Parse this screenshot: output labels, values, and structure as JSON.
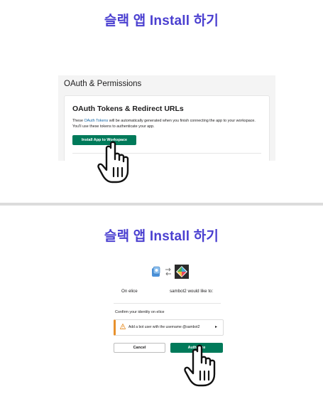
{
  "top_slide": {
    "heading": "슬랙 앱 Install 하기",
    "panel_title": "OAuth & Permissions",
    "card_title": "OAuth Tokens & Redirect URLs",
    "description_prefix": "These ",
    "description_link": "OAuth Tokens",
    "description_suffix": " will be automatically generated when you finish connecting the app to your workspace. You'll use these tokens to authenticate your app.",
    "install_button": "Install App to Workspace"
  },
  "bottom_slide": {
    "heading": "슬랙 앱 Install 하기",
    "workspace_name": "On elice",
    "request_text": "sambot2 would like to:",
    "confirm_identity": "Confirm your identity on elice",
    "permission_text": "Add a bot user with the username @sambot2",
    "permission_chevron": "▸",
    "cancel_button": "Cancel",
    "authorize_button": "Authorize"
  },
  "colors": {
    "heading": "#4a3fd0",
    "slack_green": "#007a5a",
    "link_blue": "#1264a3",
    "warning_orange": "#e8912d"
  },
  "icons": [
    "hand-pointer-icon",
    "app-icon",
    "exchange-arrows-icon",
    "workspace-logo-icon",
    "warning-icon",
    "chevron-right-icon"
  ]
}
